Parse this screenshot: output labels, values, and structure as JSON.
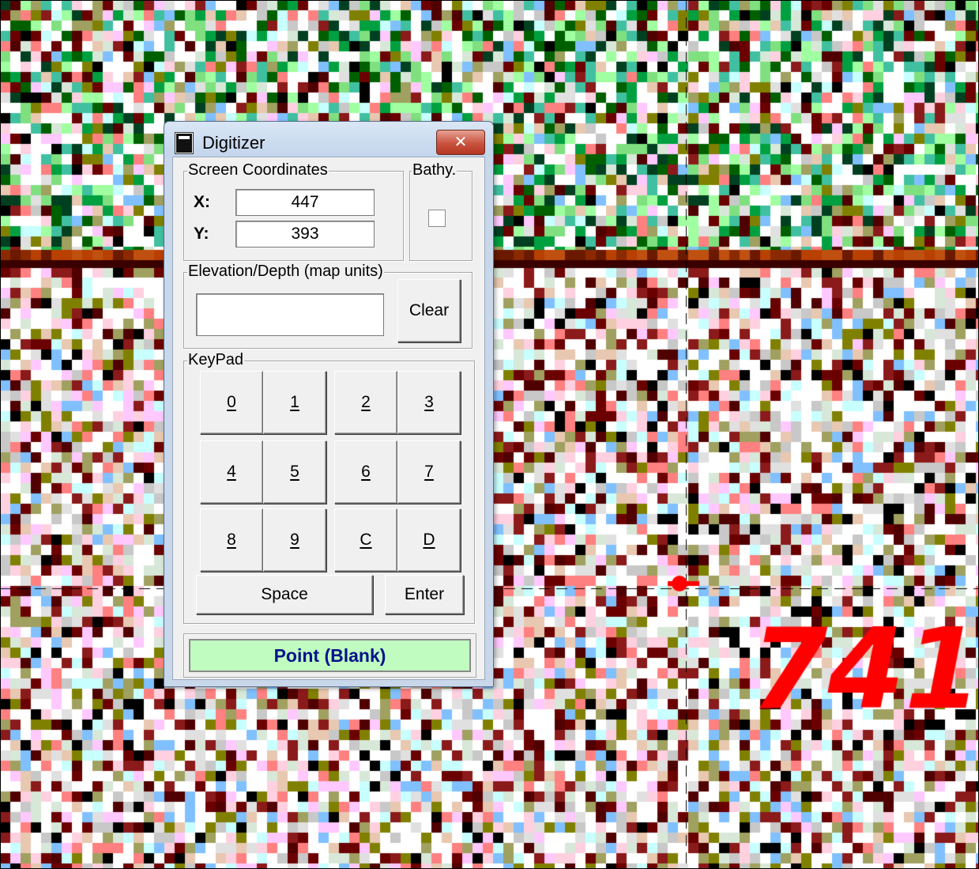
{
  "window": {
    "title": "Digitizer",
    "close_glyph": "✕"
  },
  "screen_coordinates": {
    "legend": "Screen Coordinates",
    "x_label": "X:",
    "x_value": "447",
    "y_label": "Y:",
    "y_value": "393"
  },
  "bathy": {
    "legend": "Bathy.",
    "checked": false
  },
  "elevation": {
    "legend": "Elevation/Depth (map units)",
    "value": "",
    "clear_label": "Clear"
  },
  "keypad": {
    "legend": "KeyPad",
    "keys": [
      "0",
      "1",
      "2",
      "3",
      "4",
      "5",
      "6",
      "7",
      "8",
      "9",
      "C",
      "D"
    ],
    "space_label": "Space",
    "enter_label": "Enter"
  },
  "status": {
    "text": "Point (Blank)",
    "color": "#c0fcc0"
  },
  "map": {
    "overlay_text": "741",
    "overlay_color": "#ff0000",
    "crosshair_color": "#000000"
  }
}
